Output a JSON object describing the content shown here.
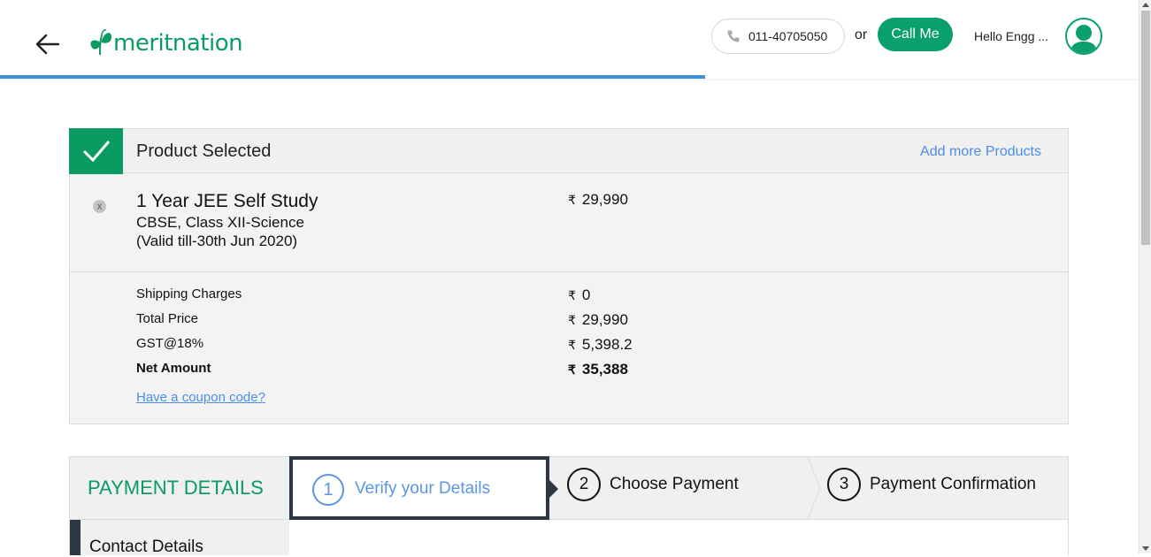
{
  "header": {
    "logo_text": "meritnation",
    "phone_number": "011-40705050",
    "or_text": "or",
    "call_label": "Call Me",
    "greeting": "Hello Engg ...",
    "progress_fraction": 0.619
  },
  "product": {
    "panel_title": "Product Selected",
    "add_more_label": "Add more Products",
    "remove_label": "X",
    "item": {
      "name": "1 Year JEE Self Study",
      "board": "CBSE, Class XII-Science",
      "validity": "(Valid till-30th Jun 2020)",
      "currency": "₹",
      "price": "29,990"
    },
    "summary": [
      {
        "label": "Shipping Charges",
        "currency": "₹",
        "value": "0"
      },
      {
        "label": "Total Price",
        "currency": "₹",
        "value": "29,990"
      },
      {
        "label": "GST@18%",
        "currency": "₹",
        "value": "5,398.2"
      },
      {
        "label": "Net Amount",
        "currency": "₹",
        "value": "35,388"
      }
    ],
    "coupon_label": "Have a coupon code?"
  },
  "payment": {
    "title": "PAYMENT DETAILS",
    "steps": [
      {
        "number": "1",
        "label": "Verify your Details"
      },
      {
        "number": "2",
        "label": "Choose Payment"
      },
      {
        "number": "3",
        "label": "Payment Confirmation"
      }
    ],
    "section_label": "Contact Details"
  },
  "colors": {
    "brand_green": "#0a9b63",
    "link_blue": "#4a8ee8",
    "dark_navy": "#2d3746"
  }
}
